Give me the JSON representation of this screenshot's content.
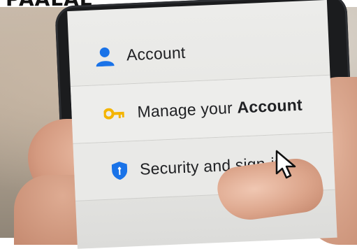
{
  "banner": {
    "text": "PAALAL"
  },
  "menu": {
    "items": [
      {
        "label": "Account",
        "icon": "person-icon",
        "color": "#1a73e8"
      },
      {
        "label_prefix": "Manage your",
        "label_emphasis": "Account",
        "icon": "key-icon",
        "color": "#f4b400"
      },
      {
        "label": "Security and sign-in",
        "icon": "shield-icon",
        "color": "#1a73e8"
      }
    ]
  },
  "pointer": {
    "icon": "mouse-pointer-icon"
  }
}
